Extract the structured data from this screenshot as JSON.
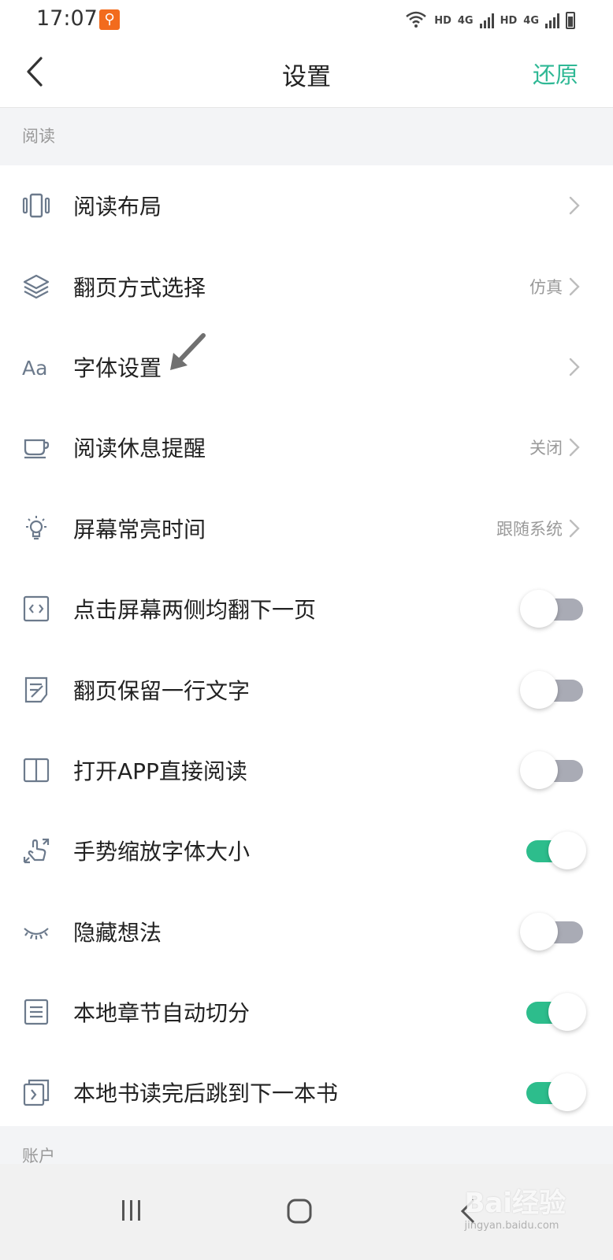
{
  "status_bar": {
    "time": "17:07",
    "hd_label_1": "HD",
    "net_label_1": "4G",
    "hd_label_2": "HD",
    "net_label_2": "4G"
  },
  "header": {
    "title": "设置",
    "restore_label": "还原"
  },
  "sections": {
    "reading": "阅读",
    "account": "账户"
  },
  "rows": [
    {
      "label": "阅读布局",
      "icon": "layout-icon",
      "type": "link",
      "value": ""
    },
    {
      "label": "翻页方式选择",
      "icon": "layers-icon",
      "type": "link",
      "value": "仿真"
    },
    {
      "label": "字体设置",
      "icon": "font-icon",
      "type": "link",
      "value": ""
    },
    {
      "label": "阅读休息提醒",
      "icon": "cup-icon",
      "type": "link",
      "value": "关闭"
    },
    {
      "label": "屏幕常亮时间",
      "icon": "bulb-icon",
      "type": "link",
      "value": "跟随系统"
    },
    {
      "label": "点击屏幕两侧均翻下一页",
      "icon": "code-page-icon",
      "type": "toggle",
      "on": false
    },
    {
      "label": "翻页保留一行文字",
      "icon": "note-icon",
      "type": "toggle",
      "on": false
    },
    {
      "label": "打开APP直接阅读",
      "icon": "book-open-icon",
      "type": "toggle",
      "on": false
    },
    {
      "label": "手势缩放字体大小",
      "icon": "gesture-icon",
      "type": "toggle",
      "on": true
    },
    {
      "label": "隐藏想法",
      "icon": "closed-eye-icon",
      "type": "toggle",
      "on": false
    },
    {
      "label": "本地章节自动切分",
      "icon": "list-icon",
      "type": "toggle",
      "on": true
    },
    {
      "label": "本地书读完后跳到下一本书",
      "icon": "next-book-icon",
      "type": "toggle",
      "on": true
    }
  ],
  "colors": {
    "accent": "#2fb895",
    "toggle_on": "#2dbd8c",
    "toggle_off": "#a9abb5",
    "section_bg": "#f3f4f6"
  },
  "watermark": {
    "brand": "Bai经验",
    "url": "jingyan.baidu.com"
  }
}
